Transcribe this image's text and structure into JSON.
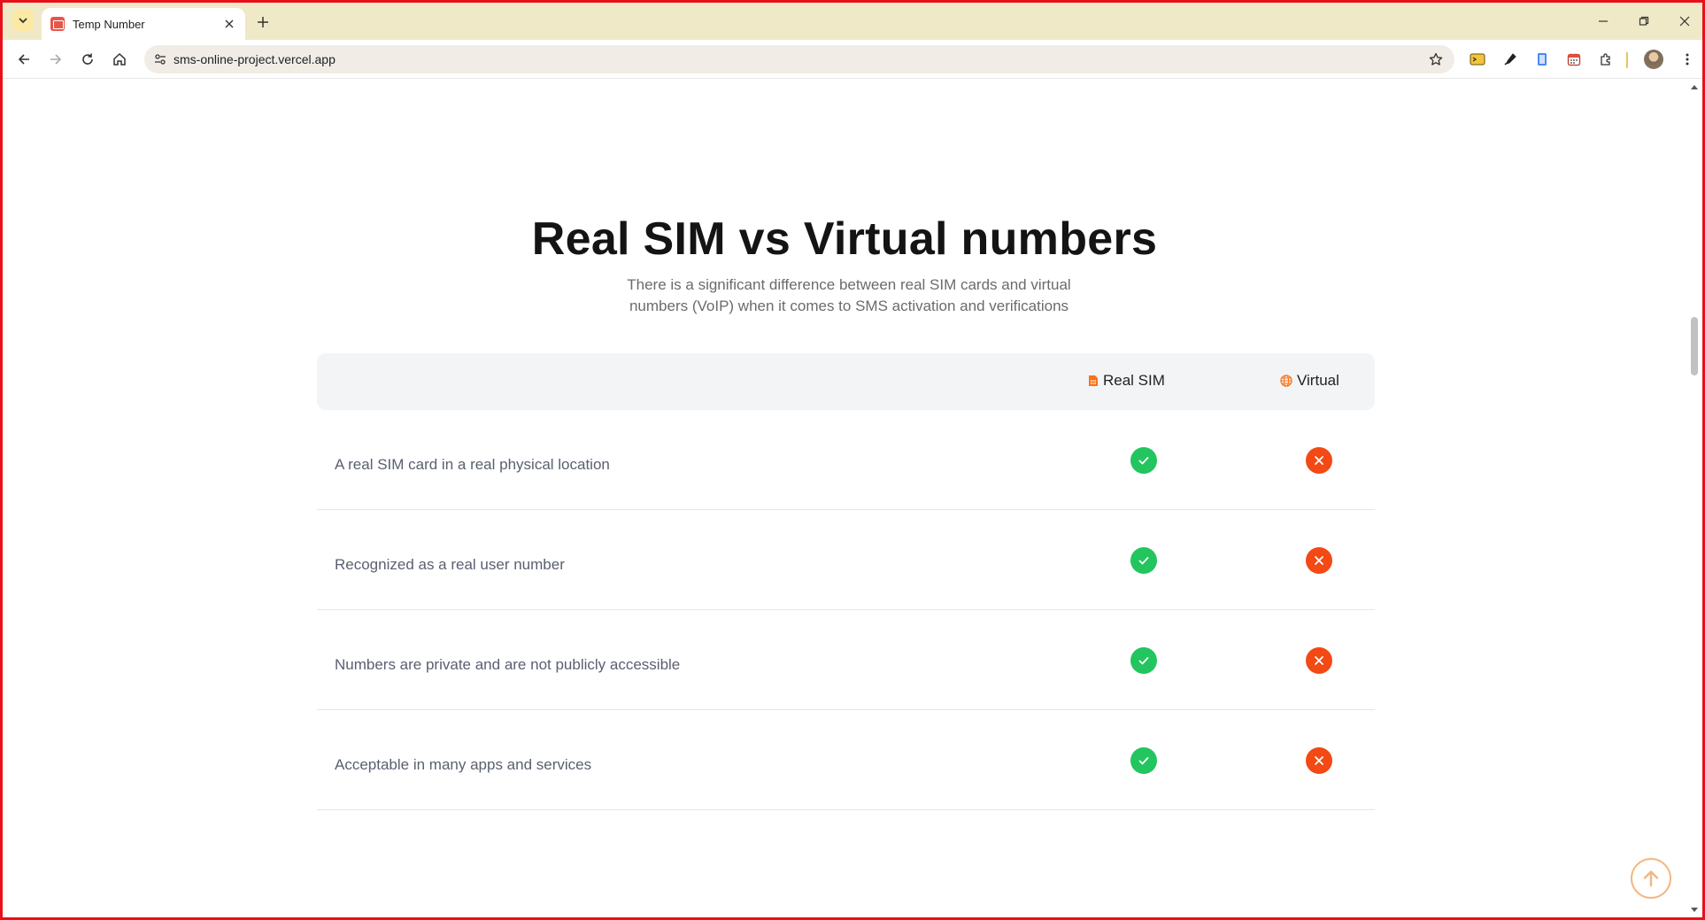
{
  "browser": {
    "tab_title": "Temp Number",
    "url": "sms-online-project.vercel.app"
  },
  "section": {
    "heading": "Real SIM vs Virtual numbers",
    "subtitle": "There is a significant difference between real SIM cards and virtual numbers (VoIP) when it comes to SMS activation and verifications"
  },
  "table": {
    "columns": {
      "real": "Real SIM",
      "virtual": "Virtual"
    },
    "rows": [
      {
        "label": "A real SIM card in a real physical location",
        "real": true,
        "virtual": false
      },
      {
        "label": "Recognized as a real user number",
        "real": true,
        "virtual": false
      },
      {
        "label": "Numbers are private and are not publicly accessible",
        "real": true,
        "virtual": false
      },
      {
        "label": "Acceptable in many apps and services",
        "real": true,
        "virtual": false
      }
    ]
  },
  "colors": {
    "check": "#22c55e",
    "cross": "#f24915",
    "accent": "#f97316",
    "frame": "#e8101a"
  },
  "icons": {
    "real_column": "sim-card-icon",
    "virtual_column": "globe-icon",
    "yes": "check-icon",
    "no": "x-icon",
    "back_to_top": "arrow-up-circle-icon"
  }
}
